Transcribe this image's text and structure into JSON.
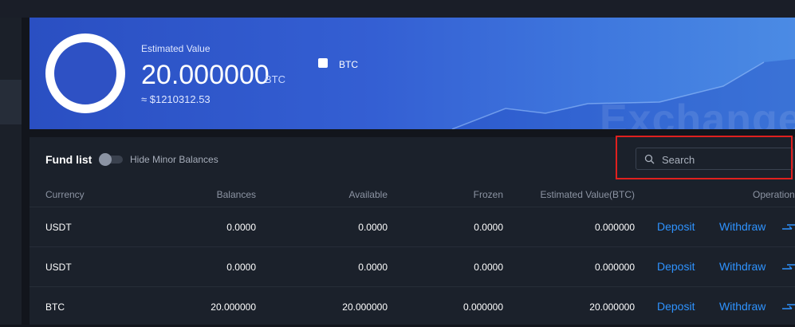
{
  "banner": {
    "estimated_label": "Estimated Value",
    "estimated_value": "20.000000",
    "estimated_unit": "BTC",
    "usd_value": "≈ $1210312.53",
    "legend_label": "BTC",
    "watermark": "Exchange"
  },
  "fund_list": {
    "title": "Fund list",
    "hide_minor_label": "Hide Minor Balances",
    "hide_minor_enabled": false,
    "search_placeholder": "Search",
    "columns": {
      "currency": "Currency",
      "balances": "Balances",
      "available": "Available",
      "frozen": "Frozen",
      "estimated": "Estimated Value(BTC)",
      "operation": "Operation"
    },
    "deposit_label": "Deposit",
    "withdraw_label": "Withdraw",
    "rows": [
      {
        "currency": "USDT",
        "balances": "0.0000",
        "available": "0.0000",
        "frozen": "0.0000",
        "estimated": "0.000000"
      },
      {
        "currency": "USDT",
        "balances": "0.0000",
        "available": "0.0000",
        "frozen": "0.0000",
        "estimated": "0.000000"
      },
      {
        "currency": "BTC",
        "balances": "20.000000",
        "available": "20.000000",
        "frozen": "0.000000",
        "estimated": "20.000000"
      }
    ]
  },
  "colors": {
    "accent": "#2e93ff",
    "highlight": "#e0201e",
    "banner_start": "#2a4fc2",
    "banner_end": "#4b8be4"
  },
  "icons": {
    "search": "search-icon",
    "transfer": "transfer-icon"
  }
}
